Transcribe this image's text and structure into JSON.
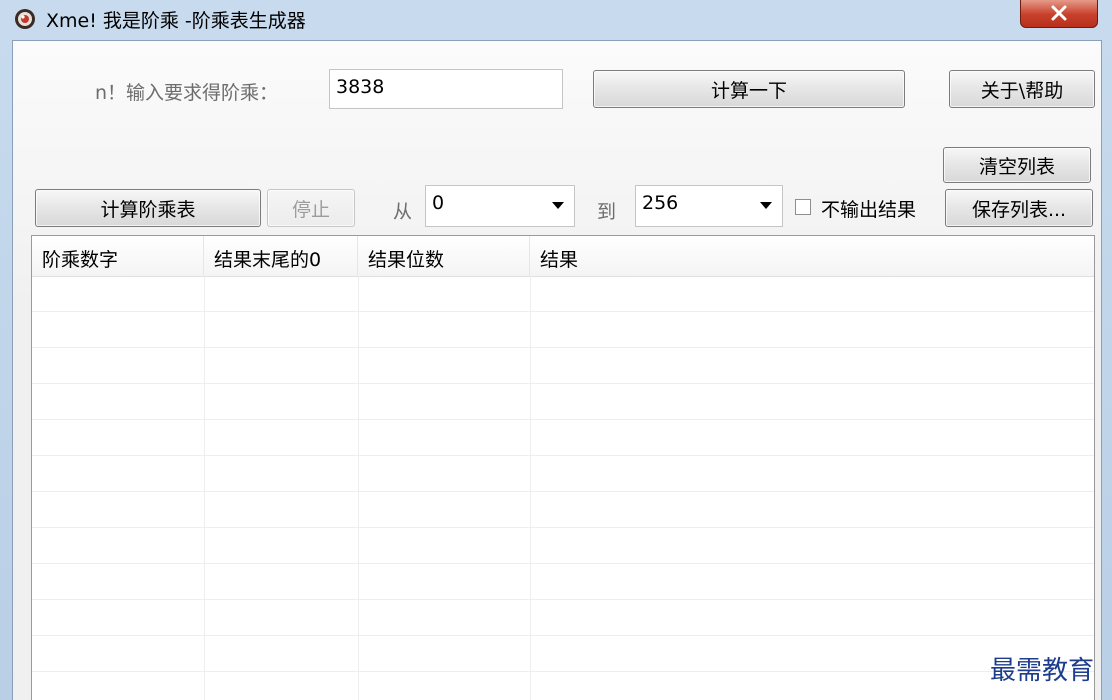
{
  "window": {
    "title": "Xme! 我是阶乘  -阶乘表生成器",
    "close_symbol": "✕"
  },
  "single": {
    "label": "n！输入要求得阶乘：",
    "value": "3838",
    "calc_button": "计算一下",
    "about_button": "关于\\帮助"
  },
  "table_controls": {
    "clear_button": "清空列表",
    "calc_table_button": "计算阶乘表",
    "stop_button": "停止",
    "from_label": "从",
    "from_value": "0",
    "to_label": "到",
    "to_value": "256",
    "no_output_label": "不输出结果",
    "no_output_checked": false,
    "save_button": "保存列表..."
  },
  "list": {
    "columns": [
      "阶乘数字",
      "结果末尾的0",
      "结果位数",
      "结果"
    ],
    "rows": []
  },
  "watermark": "最需教育"
}
